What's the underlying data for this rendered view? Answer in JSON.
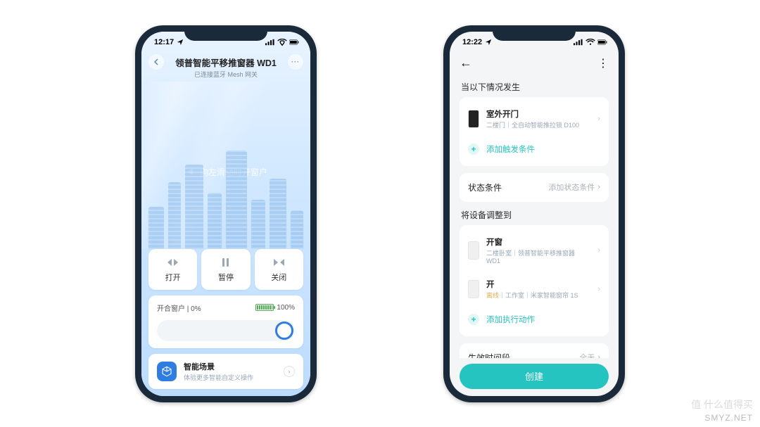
{
  "watermark_cn": "值 什么值得买",
  "watermark_en": "SMYZ.NET",
  "left": {
    "status_time": "12:17",
    "title": "领普智能平移推窗器 WD1",
    "subtitle": "已连接蓝牙 Mesh 网关",
    "swipe_hint": "向左滑动时开窗户",
    "controls": {
      "open": "打开",
      "pause": "暂停",
      "close": "关闭"
    },
    "slider": {
      "label": "开合窗户",
      "open_pct": "0%",
      "battery_pct": "100%"
    },
    "scene": {
      "title": "智能场景",
      "subtitle": "体验更多智能自定义操作"
    }
  },
  "right": {
    "status_time": "12:22",
    "section_trigger": "当以下情况发生",
    "trigger": {
      "title": "室外开门",
      "sub": "二楼门｜全自动智能推拉锁 D100"
    },
    "add_trigger": "添加触发条件",
    "state_row": {
      "label": "状态条件",
      "value": "添加状态条件"
    },
    "section_action": "将设备调整到",
    "action1": {
      "title": "开窗",
      "sub": "二楼卧室｜领普智能平移推窗器 WD1"
    },
    "action2": {
      "title": "开",
      "warn": "离线",
      "sub": "｜工作室｜米家智能窗帘 1S"
    },
    "add_action": "添加执行动作",
    "time_row": {
      "label": "生效时间段",
      "value": "全天"
    },
    "create": "创建"
  }
}
